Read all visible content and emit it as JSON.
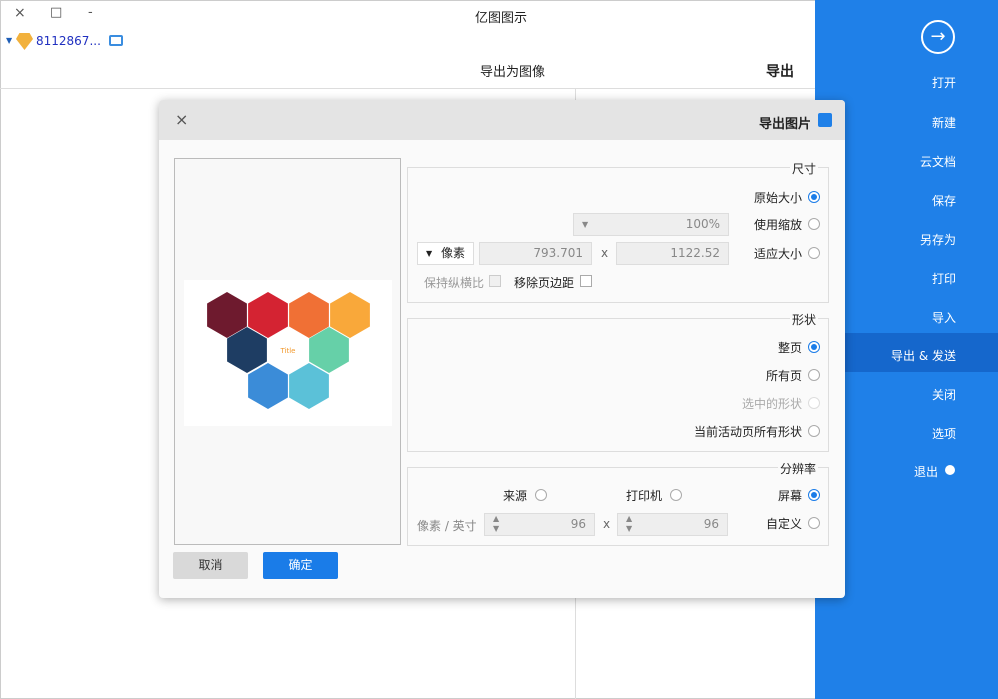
{
  "window": {
    "title": "亿图图示",
    "user": "8112867...",
    "minimize": "-",
    "maximize": "□",
    "close": "×"
  },
  "header": {
    "section": "导出",
    "subtitle": "导出为图像"
  },
  "sidebar": {
    "items": [
      {
        "label": "打开"
      },
      {
        "label": "新建"
      },
      {
        "label": "云文档"
      },
      {
        "label": "保存"
      },
      {
        "label": "另存为"
      },
      {
        "label": "打印"
      },
      {
        "label": "导入"
      },
      {
        "label": "导出 & 发送",
        "active": true
      },
      {
        "label": "关闭"
      },
      {
        "label": "选项"
      },
      {
        "label": "退出"
      }
    ],
    "accent": "#1f80e8"
  },
  "dialog": {
    "title": "导出图片",
    "size": {
      "label": "尺寸",
      "original": "原始大小",
      "use_zoom": "使用缩放",
      "zoom_value": "100%",
      "fit": "适应大小",
      "width": "1122.52",
      "x": "x",
      "height": "793.701",
      "unit": "像素",
      "remove_margin": "移除页边距",
      "keep_ratio": "保持纵横比",
      "selected": "original"
    },
    "shape": {
      "label": "形状",
      "options": [
        "整页",
        "所有页",
        "选中的形状",
        "当前活动页所有形状"
      ],
      "selected": 0
    },
    "resolution": {
      "label": "分辨率",
      "screen": "屏幕",
      "printer": "打印机",
      "source": "来源",
      "custom": "自定义",
      "dpi_x": "96",
      "x": "x",
      "dpi_y": "96",
      "unit": "像素 / 英寸",
      "selected": "screen"
    },
    "cancel": "取消",
    "ok": "确定"
  }
}
